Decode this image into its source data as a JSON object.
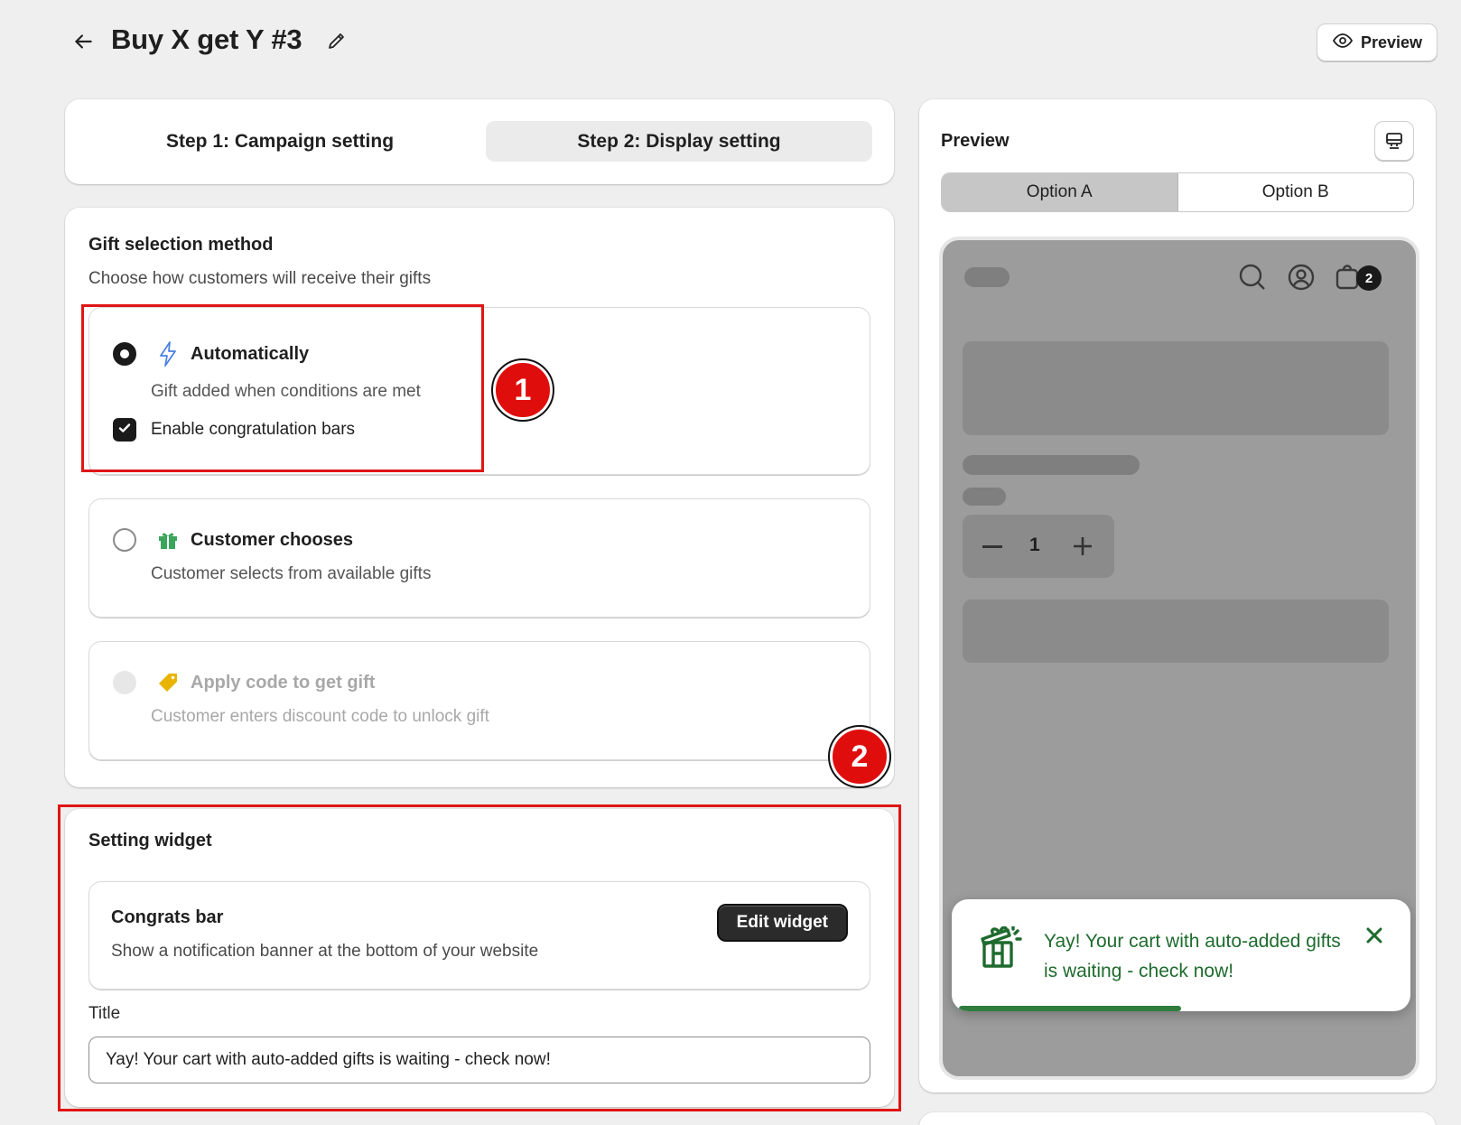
{
  "header": {
    "title": "Buy X get Y #3",
    "preview_label": "Preview"
  },
  "steps": {
    "step1": "Step 1: Campaign setting",
    "step2": "Step 2: Display setting"
  },
  "gift_selection": {
    "title": "Gift selection method",
    "subtitle": "Choose how customers will receive their gifts",
    "options": [
      {
        "label": "Automatically",
        "desc": "Gift added when conditions are met",
        "checkbox_label": "Enable congratulation bars",
        "selected": true
      },
      {
        "label": "Customer chooses",
        "desc": "Customer selects from available gifts",
        "selected": false
      },
      {
        "label": "Apply code to get gift",
        "desc": "Customer enters discount code to unlock gift",
        "selected": false,
        "disabled": true
      }
    ]
  },
  "badges": {
    "one": "1",
    "two": "2"
  },
  "setting_widget": {
    "title": "Setting widget",
    "congrats_title": "Congrats bar",
    "congrats_desc": "Show a notification banner at the bottom of your website",
    "edit_label": "Edit widget",
    "field_label": "Title",
    "field_value": "Yay! Your cart with auto-added gifts is waiting - check now!"
  },
  "preview": {
    "title": "Preview",
    "tabs": [
      "Option A",
      "Option B"
    ],
    "cart_count": "2",
    "quantity": "1",
    "congrats_message": "Yay! Your cart with auto-added gifts is waiting - check now!",
    "progress": 0.5
  },
  "colors": {
    "highlight": "#e01515",
    "badge": "#e00d0d",
    "congrats_green": "#1f6b2e"
  },
  "icons": [
    "back-arrow-icon",
    "pencil-icon",
    "eye-icon",
    "bolt-icon",
    "gift-icon",
    "tag-icon",
    "checkmark-icon",
    "monitor-icon",
    "search-icon",
    "user-icon",
    "cart-icon",
    "close-icon"
  ]
}
